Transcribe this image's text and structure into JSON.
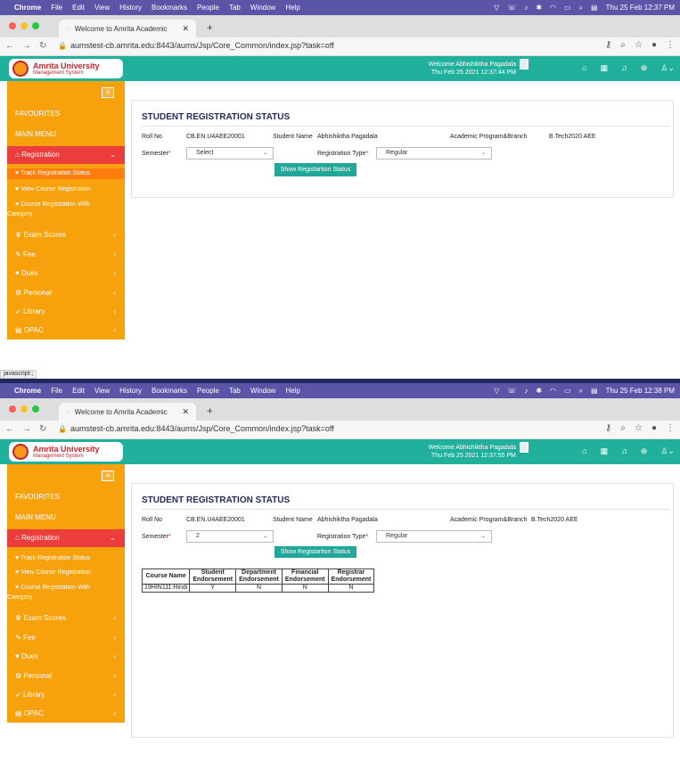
{
  "screens": [
    {
      "macbar": {
        "app": "Chrome",
        "menus": [
          "File",
          "Edit",
          "View",
          "History",
          "Bookmarks",
          "People",
          "Tab",
          "Window",
          "Help"
        ],
        "datetime": "Thu 25 Feb  12:37 PM"
      },
      "browser": {
        "tab_title": "Welcome to Amrita Academic",
        "url": "aumstest-cb.amrita.edu:8443/aums/Jsp/Core_Common/index.jsp?task=off"
      },
      "header": {
        "logo_title": "Amrita University",
        "logo_subtitle": "Management System",
        "welcome": "Welcome Abhishiktha Pagadala",
        "timestamp": "Thu Feb 25 2021 12:37:44 PM"
      },
      "sidebar": {
        "favourites": "FAVOURITES",
        "main_menu": "MAIN MENU",
        "registration": "Registration",
        "sub_items": [
          "Track Registration Status",
          "View Course Registration",
          "Course Registration With",
          "Category"
        ],
        "items": [
          "Exam Scores",
          "Fee",
          "Dues",
          "Personal",
          "Library",
          "OPAC"
        ]
      },
      "form": {
        "title": "STUDENT REGISTRATION STATUS",
        "roll_label": "Roll No",
        "roll_value": "CB.EN.U4AEE20001",
        "name_label": "Student Name",
        "name_value": "Abhishiktha Pagadala",
        "program_label": "Academic Program&Branch",
        "program_value": "B.Tech2020 AEE",
        "semester_label": "Semester",
        "semester_value": "Select",
        "regtype_label": "Registration Type",
        "regtype_value": "Regular",
        "button": "Show Registartion Status"
      },
      "statusbar": "javascript:;"
    },
    {
      "macbar": {
        "app": "Chrome",
        "menus": [
          "File",
          "Edit",
          "View",
          "History",
          "Bookmarks",
          "People",
          "Tab",
          "Window",
          "Help"
        ],
        "datetime": "Thu 25 Feb  12:38 PM"
      },
      "browser": {
        "tab_title": "Welcome to Amrita Academic",
        "url": "aumstest-cb.amrita.edu:8443/aums/Jsp/Core_Common/index.jsp?task=off"
      },
      "header": {
        "logo_title": "Amrita University",
        "logo_subtitle": "Management System",
        "welcome": "Welcome Abhishiktha Pagadala",
        "timestamp": "Thu Feb 25 2021 12:37:55 PM"
      },
      "sidebar": {
        "favourites": "FAVOURITES",
        "main_menu": "MAIN MENU",
        "registration": "Registration",
        "sub_items": [
          "Track Registration Status",
          "View Course Registration",
          "Course Registration With",
          "Category"
        ],
        "items": [
          "Exam Scores",
          "Fee",
          "Dues",
          "Personal",
          "Library",
          "OPAC"
        ]
      },
      "form": {
        "title": "STUDENT REGISTRATION STATUS",
        "roll_label": "Roll No",
        "roll_value": "CB.EN.U4AEE20001",
        "name_label": "Student Name",
        "name_value": "Abhishiktha Pagadala",
        "program_label": "Academic Program&Branch",
        "program_value": "B.Tech2020 AEE",
        "semester_label": "Semester",
        "semester_value": "2",
        "regtype_label": "Registration Type",
        "regtype_value": "Regular",
        "button": "Show Registartion Status"
      },
      "table": {
        "headers": [
          [
            "Course Name"
          ],
          [
            "Student",
            "Endorsement"
          ],
          [
            "Department",
            "Endorsement"
          ],
          [
            "Financial",
            "Endorsement"
          ],
          [
            "Registrar",
            "Endorsement"
          ]
        ],
        "rows": [
          [
            "19HIN111:Hindi",
            "Y",
            "N",
            "N",
            "N"
          ]
        ]
      }
    }
  ],
  "colors": {
    "mac_menubar": "#5b55a8",
    "header_teal": "#21b09b",
    "sidebar_orange": "#f7a10c",
    "registration_red": "#ec3d3d",
    "active_subitem": "#ff7f0e",
    "button_teal": "#21a89b",
    "title_navy": "#1f2a56"
  },
  "icons": {
    "sidebar_registration": "home-icon",
    "sidebar_subitems": "heart-icon",
    "exam_scores": "trophy-icon",
    "fee": "pen-icon",
    "dues": "heart-icon",
    "personal": "gear-icon",
    "library": "send-icon",
    "opac": "book-icon"
  }
}
